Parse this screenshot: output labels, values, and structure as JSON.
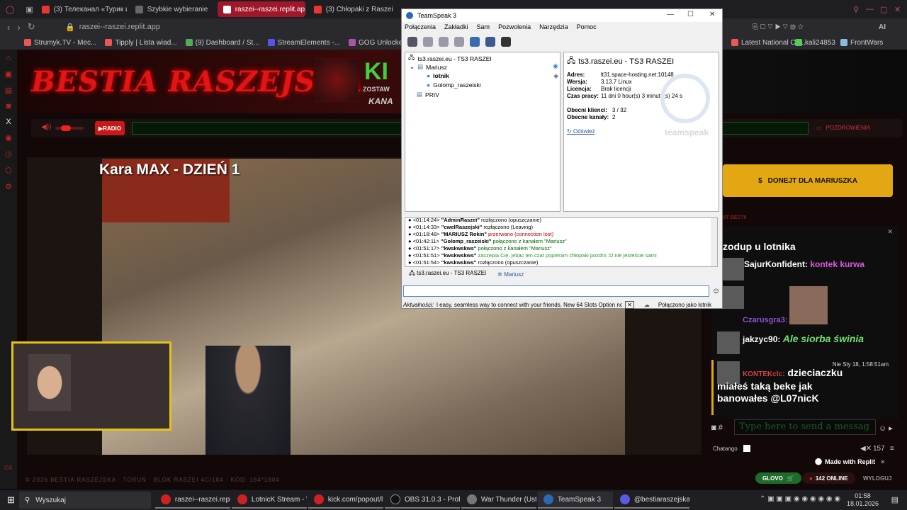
{
  "browser": {
    "tabs": [
      {
        "label": "(3) Телеканал «Турик и К",
        "active": false
      },
      {
        "label": "Szybkie wybieranie",
        "active": false
      },
      {
        "label": "raszei--raszei.replit.app",
        "active": true
      },
      {
        "label": "(3) Chłopaki z Raszei - PR",
        "active": false
      }
    ],
    "url": "raszei--raszei.replit.app",
    "bookmarks_left": [
      "Strumyk.TV - Mec...",
      "Tipply | Lista wiad...",
      "(9) Dashboard / St...",
      "StreamElements -...",
      "GOG Unlocked » F..."
    ],
    "bookmarks_right": [
      "Latest National Co...",
      "kali24853",
      "FrontWars"
    ],
    "toolbar_right_label": "AI"
  },
  "site": {
    "brand": "BESTIA RASZEJSKA",
    "banner_fragment_top": "KI",
    "banner_fragment_1": "ZOSTAW",
    "banner_fragment_2": "KANA",
    "radio_label": "RADIO",
    "greeting_label": "POZDROWIENIA",
    "overlay_title": "Kara MAX - DZIEŃ 1",
    "donate_label": "DONEJT DLA MARIUSZKA",
    "chat_header": "AT BESTII",
    "footer": "© 2026 BESTIA RASZEJSKA · TORUŃ · BLOK RASZEI 4C/184 · KOD: 184*1804",
    "glovo_label": "GLOVO",
    "online_label": "142 ONLINE",
    "logout_label": "WYLOGUJ",
    "made_with": "Made with Replit"
  },
  "chat": {
    "messages": [
      {
        "author": "",
        "text": "zodup u lotnika"
      },
      {
        "author": "SajurKonfident:",
        "text": "kontek kurwa"
      },
      {
        "author": "Czarusgra3:",
        "text": ""
      },
      {
        "author": "jakzyc90:",
        "text": "Ale siorba świnia"
      },
      {
        "author": "KONTEKclc:",
        "text": "dzieciaczku miałeś taką beke jak banowałes @L07nicK"
      }
    ],
    "timestamp": "Nie Sty 18, 1:58:51am",
    "input_placeholder": "Type here to send a messag",
    "service": "Chatango",
    "viewer_count": "157"
  },
  "teamspeak": {
    "window_title": "TeamSpeak 3",
    "menu": [
      "Połączenia",
      "Zakładki",
      "Sam",
      "Pozwolenia",
      "Narzędzia",
      "Pomoc"
    ],
    "tree": {
      "server": "ts3.raszei.eu - TS3 RASZEI",
      "channel": "Mariusz",
      "users": [
        "lotnik",
        "Golomp_raszeiski"
      ],
      "channel2": "PRIV"
    },
    "info": {
      "title": "ts3.raszei.eu - TS3 RASZEI",
      "rows": [
        {
          "k": "Adres:",
          "v": "lt31.space-hosting.net:10148"
        },
        {
          "k": "Wersja:",
          "v": "3.13.7 Linux"
        },
        {
          "k": "Licencja:",
          "v": "Brak licencji"
        },
        {
          "k": "Czas pracy:",
          "v": "11 dni 0 hour(s) 3 minute(s) 24 s"
        },
        {
          "k": "Obecni klienci:",
          "v": "3 / 32"
        },
        {
          "k": "Obecne kanały:",
          "v": "2"
        }
      ],
      "refresh": "Odśwież",
      "brand": "teamspeak"
    },
    "log": [
      {
        "t": "<01:14:24>",
        "n": "\"AdminRaszei\"",
        "m": "rozłączono (opuszczanie)",
        "c": "#333"
      },
      {
        "t": "<01:14:33>",
        "n": "\"cwelRaszejski\"",
        "m": "rozłączono (Leaving)",
        "c": "#333"
      },
      {
        "t": "<01:18:48>",
        "n": "\"MARIUSZ Rokin\"",
        "m": "przerwano (connection lost)",
        "c": "#b00"
      },
      {
        "t": "<01:42:11>",
        "n": "\"Golomp_raszeiski\"",
        "m": "połączono z kanałem \"Mariusz\"",
        "c": "#060"
      },
      {
        "t": "<01:51:17>",
        "n": "\"kwskwskws\"",
        "m": "połączono z kanałem \"Mariusz\"",
        "c": "#060"
      },
      {
        "t": "<01:51:51>",
        "n": "\"kwskwskws\"",
        "m": "zaczepia Cię. jebac ten czat popieram chłopaki pozdro :D nie jesteście sami",
        "c": "#2a9a2a"
      },
      {
        "t": "<01:51:54>",
        "n": "\"kwskwskws\"",
        "m": "rozłączono (opuszczanie)",
        "c": "#333"
      }
    ],
    "tabs": [
      "ts3.raszei.eu - TS3 RASZEI",
      "Mariusz"
    ],
    "status_label": "Aktualności:",
    "status_text": "l easy, seamless way to connect with your friends. New 64 Slots Option now avail",
    "connected": "Połączono jako lotnik"
  },
  "taskbar": {
    "search": "Wyszukaj",
    "items": [
      "raszei--raszei.replit...",
      "LotnicK Stream - W...",
      "kick.com/popout/l...",
      "OBS 31.0.3 - Profile:...",
      "War Thunder (Usta...",
      "TeamSpeak 3",
      "@bestiaraszejska - ..."
    ],
    "time": "01:58",
    "date": "18.01.2026"
  }
}
